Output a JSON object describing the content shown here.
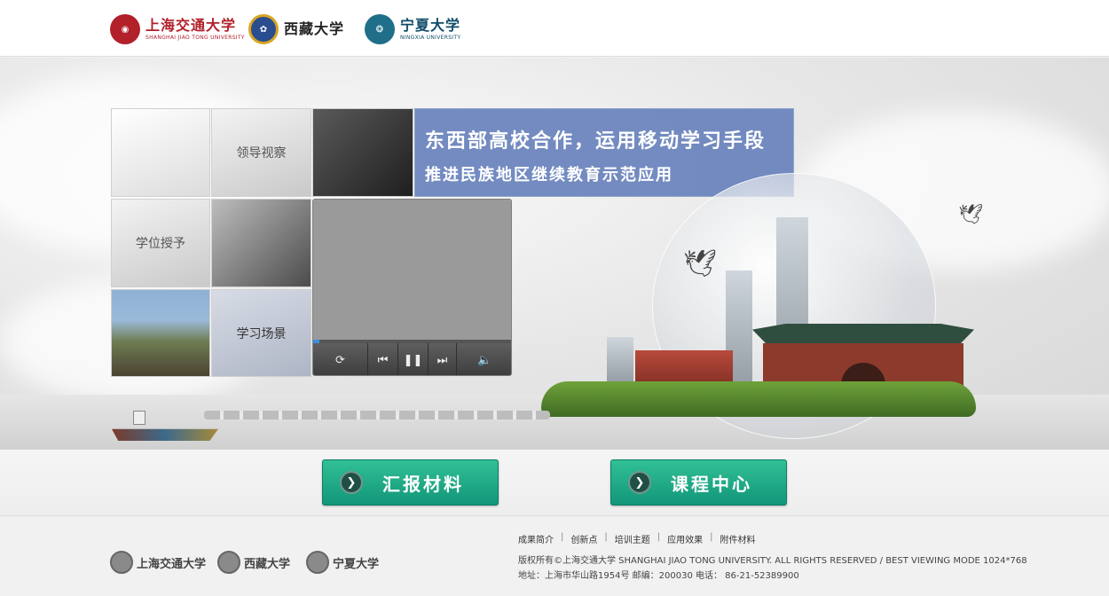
{
  "header": {
    "logos": [
      {
        "name": "上海交通大学",
        "en": "SHANGHAI JIAO TONG UNIVERSITY"
      },
      {
        "name": "西藏大学",
        "en": ""
      },
      {
        "name": "宁夏大学",
        "en": "NINGXIA UNIVERSITY"
      }
    ]
  },
  "banner": {
    "tiles": {
      "leadership": "领导视察",
      "degree": "学位授予",
      "study": "学习场景"
    },
    "headline": {
      "line1": "东西部高校合作，运用移动学习手段",
      "line2": "推进民族地区继续教育示范应用"
    },
    "player": {
      "progress_fraction": 0.03,
      "icons": [
        "repeat-icon",
        "previous-icon",
        "pause-icon",
        "next-icon",
        "volume-icon"
      ]
    }
  },
  "buttons": {
    "report": "汇报材料",
    "course": "课程中心"
  },
  "footer": {
    "nav": [
      "成果简介",
      "创新点",
      "培训主题",
      "应用效果",
      "附件材料"
    ],
    "copyright": "版权所有©上海交通大学   SHANGHAI JIAO TONG UNIVERSITY. ALL RIGHTS RESERVED  /   BEST VIEWING MODE 1024*768",
    "address": "地址：上海市华山路1954号  邮编：200030  电话：  86-21-52389900"
  },
  "colors": {
    "accent_green": "#12967a",
    "headline_blue": "#6580ba",
    "sjtu_red": "#b2202a"
  }
}
